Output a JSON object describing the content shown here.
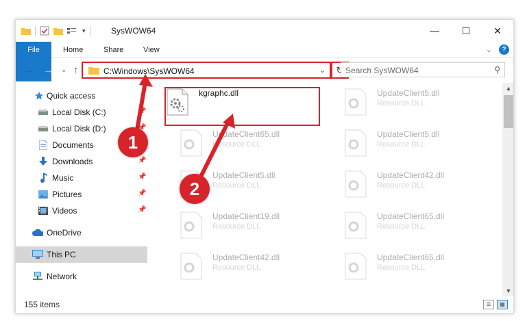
{
  "window": {
    "title": "SysWOW64",
    "controls": {
      "minimize": "—",
      "maximize": "☐",
      "close": "✕"
    }
  },
  "ribbon": {
    "tabs": [
      "File",
      "Home",
      "Share",
      "View"
    ],
    "help": "?",
    "collapse": "⌄"
  },
  "navigation": {
    "back": "←",
    "forward": "→",
    "recent": "⌄",
    "up": "↑",
    "address": "C:\\Windows\\SysWOW64",
    "dropdown": "⌄",
    "refresh": "↻",
    "search_placeholder": "Search SysWOW64",
    "search_icon": "⚲"
  },
  "sidebar": {
    "items": [
      {
        "label": "Quick access",
        "icon": "star-icon",
        "pinned": false
      },
      {
        "label": "Local Disk (C:)",
        "icon": "drive-icon",
        "pinned": true
      },
      {
        "label": "Local Disk (D:)",
        "icon": "drive-icon",
        "pinned": true
      },
      {
        "label": "Documents",
        "icon": "documents-icon",
        "pinned": true
      },
      {
        "label": "Downloads",
        "icon": "downloads-icon",
        "pinned": true
      },
      {
        "label": "Music",
        "icon": "music-icon",
        "pinned": true
      },
      {
        "label": "Pictures",
        "icon": "pictures-icon",
        "pinned": true
      },
      {
        "label": "Videos",
        "icon": "videos-icon",
        "pinned": true
      },
      {
        "label": "OneDrive",
        "icon": "cloud-icon",
        "pinned": false
      },
      {
        "label": "This PC",
        "icon": "computer-icon",
        "pinned": false,
        "selected": true
      },
      {
        "label": "Network",
        "icon": "network-icon",
        "pinned": false
      }
    ]
  },
  "files": [
    {
      "name": "kgraphc.dll",
      "type": "",
      "highlighted": true
    },
    {
      "name": "UpdateClient5.dll",
      "type": "Resource DLL"
    },
    {
      "name": "UpdateClient65.dll",
      "type": "Resource DLL"
    },
    {
      "name": "UpdateClient5.dll",
      "type": "Resource DLL"
    },
    {
      "name": "UpdateClient5.dll",
      "type": "Resource DLL"
    },
    {
      "name": "UpdateClient42.dll",
      "type": "Resource DLL"
    },
    {
      "name": "UpdateClient19.dll",
      "type": "Resource DLL"
    },
    {
      "name": "UpdateClient65.dll",
      "type": "Resource DLL"
    },
    {
      "name": "UpdateClient42.dll",
      "type": "Resource DLL"
    },
    {
      "name": "UpdateClient65.dll",
      "type": "Resource DLL"
    }
  ],
  "status": {
    "count": "155 items"
  },
  "callouts": {
    "one": "1",
    "two": "2"
  },
  "colors": {
    "accent": "#1979ca",
    "annotation": "#d8232a",
    "selected": "#d6d6d6"
  }
}
